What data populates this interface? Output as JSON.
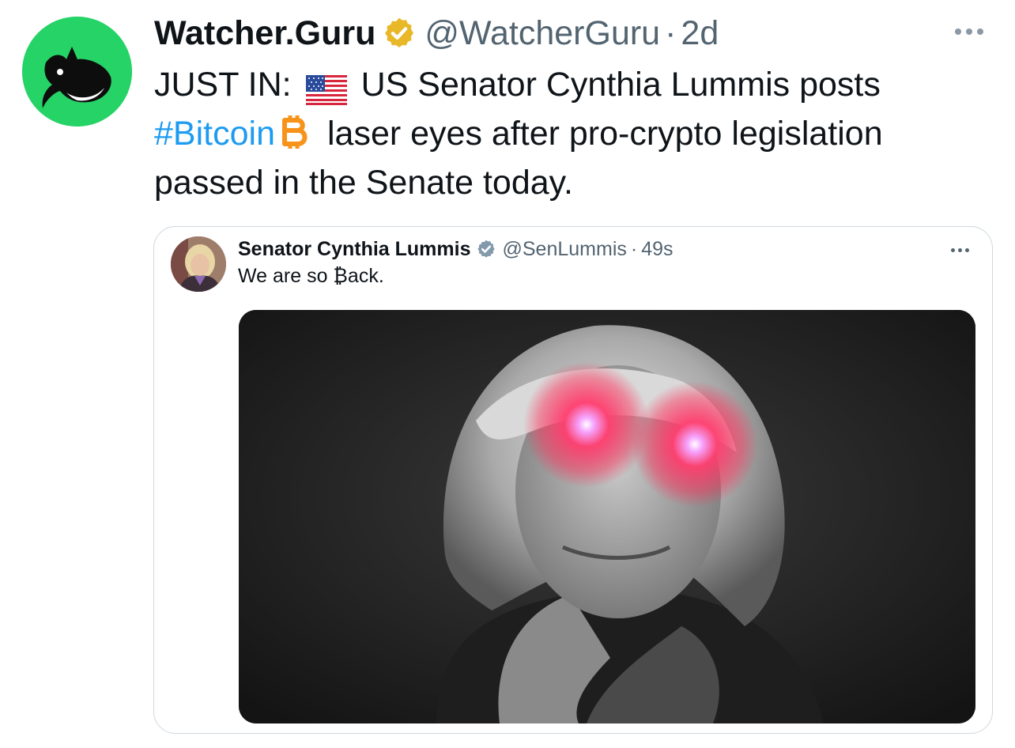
{
  "tweet": {
    "avatar_icon": "whale-logo-icon",
    "avatar_color": "#25d366",
    "display_name": "Watcher.Guru",
    "verified_icon": "gold-verified-badge-icon",
    "verified_color": "#e8b829",
    "handle": "@WatcherGuru",
    "separator": "·",
    "time": "2d",
    "more_icon": "more-options-icon",
    "text": {
      "part1": "JUST IN:",
      "flag_icon": "us-flag-emoji-icon",
      "part2": "US Senator Cynthia Lummis posts",
      "hashtag": "#Bitcoin",
      "bitcoin_icon": "bitcoin-emoji-icon",
      "part3": "laser eyes after pro-crypto legislation",
      "part4": "passed in the Senate today."
    },
    "hashtag_color": "#1d9bf0"
  },
  "quoted": {
    "avatar_icon": "senator-profile-photo",
    "display_name": "Senator Cynthia Lummis",
    "verified_icon": "gray-verified-badge-icon",
    "handle": "@SenLummis",
    "separator": "·",
    "time": "49s",
    "more_icon": "more-options-icon",
    "text": "We are so ₿ack.",
    "media_icon": "laser-eyes-portrait-image"
  }
}
